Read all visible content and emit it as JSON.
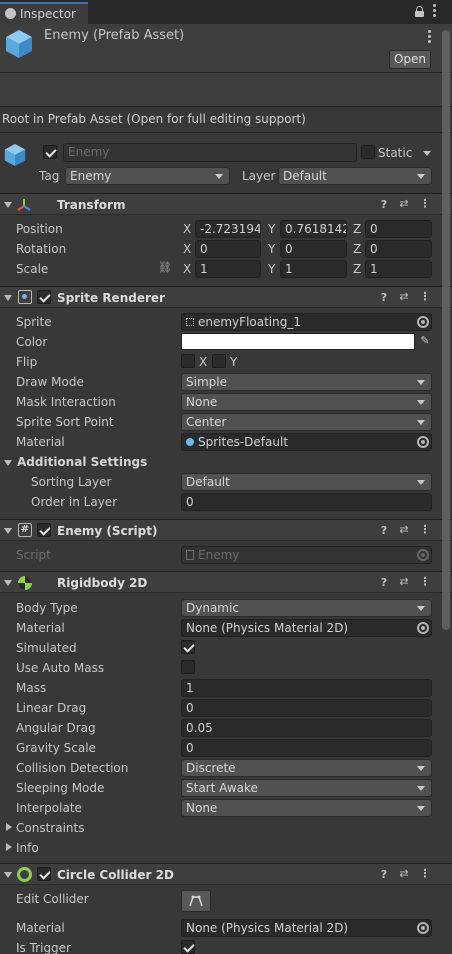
{
  "window": {
    "tab_label": "Inspector"
  },
  "header": {
    "asset_name": "Enemy (Prefab Asset)",
    "open_label": "Open"
  },
  "prefab_note": "Root in Prefab Asset (Open for full editing support)",
  "gameobject": {
    "name": "Enemy",
    "static_label": "Static",
    "tag_label": "Tag",
    "tag_value": "Enemy",
    "layer_label": "Layer",
    "layer_value": "Default"
  },
  "transform": {
    "title": "Transform",
    "position_label": "Position",
    "rotation_label": "Rotation",
    "scale_label": "Scale",
    "axis_x": "X",
    "axis_y": "Y",
    "axis_z": "Z",
    "position": {
      "x": "-2.723194",
      "y": "0.7618142",
      "z": "0"
    },
    "rotation": {
      "x": "0",
      "y": "0",
      "z": "0"
    },
    "scale": {
      "x": "1",
      "y": "1",
      "z": "1"
    }
  },
  "sprite_renderer": {
    "title": "Sprite Renderer",
    "sprite_label": "Sprite",
    "sprite_value": "enemyFloating_1",
    "color_label": "Color",
    "flip_label": "Flip",
    "flip_x": "X",
    "flip_y": "Y",
    "draw_mode_label": "Draw Mode",
    "draw_mode_value": "Simple",
    "mask_label": "Mask Interaction",
    "mask_value": "None",
    "sort_point_label": "Sprite Sort Point",
    "sort_point_value": "Center",
    "material_label": "Material",
    "material_value": "Sprites-Default",
    "additional_label": "Additional Settings",
    "sorting_layer_label": "Sorting Layer",
    "sorting_layer_value": "Default",
    "order_label": "Order in Layer",
    "order_value": "0"
  },
  "enemy_script": {
    "title": "Enemy (Script)",
    "script_label": "Script",
    "script_value": "Enemy"
  },
  "rigidbody": {
    "title": "Rigidbody 2D",
    "body_type_label": "Body Type",
    "body_type_value": "Dynamic",
    "material_label": "Material",
    "material_value": "None (Physics Material 2D)",
    "simulated_label": "Simulated",
    "auto_mass_label": "Use Auto Mass",
    "mass_label": "Mass",
    "mass_value": "1",
    "linear_drag_label": "Linear Drag",
    "linear_drag_value": "0",
    "angular_drag_label": "Angular Drag",
    "angular_drag_value": "0.05",
    "gravity_label": "Gravity Scale",
    "gravity_value": "0",
    "collision_label": "Collision Detection",
    "collision_value": "Discrete",
    "sleeping_label": "Sleeping Mode",
    "sleeping_value": "Start Awake",
    "interpolate_label": "Interpolate",
    "interpolate_value": "None",
    "constraints_label": "Constraints",
    "info_label": "Info"
  },
  "circle_collider": {
    "title": "Circle Collider 2D",
    "edit_label": "Edit Collider",
    "material_label": "Material",
    "material_value": "None (Physics Material 2D)",
    "trigger_label": "Is Trigger"
  },
  "colors": {
    "background": "#383838",
    "header": "#3e3e3e",
    "field": "#2a2a2a",
    "accent": "#3a72b0",
    "cube_icon": "#6fb7e8",
    "collider_icon": "#8bd048",
    "white_swatch": "#ffffff"
  },
  "icons": [
    "lock-icon",
    "menu-dots-icon",
    "cube-icon",
    "transform-axes-icon",
    "help-icon",
    "settings-sliders-icon",
    "sprite-icon",
    "script-hash-icon",
    "rigidbody-icon",
    "circle-collider-icon",
    "eyedropper-icon",
    "object-picker-icon",
    "link-icon",
    "edit-collider-icon"
  ]
}
